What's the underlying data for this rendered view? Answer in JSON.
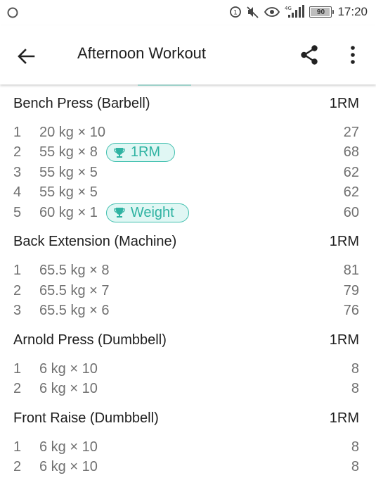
{
  "status_bar": {
    "time": "17:20",
    "battery": "90",
    "battery_level": 0.9,
    "network_label": "4G",
    "icons": [
      "circle-notification-icon",
      "data-saver-icon",
      "mute-icon",
      "eye-comfort-icon",
      "signal-icon",
      "battery-icon"
    ]
  },
  "app_bar": {
    "title": "Afternoon Workout",
    "icons": [
      "back-arrow-icon",
      "share-icon",
      "more-vert-icon"
    ]
  },
  "accent_color": "#3fbfae",
  "exercises": [
    {
      "name": "Bench Press (Barbell)",
      "metric": "1RM",
      "sets": [
        {
          "num": "1",
          "desc": "20 kg × 10",
          "value": "27",
          "badge": ""
        },
        {
          "num": "2",
          "desc": "55 kg × 8",
          "value": "68",
          "badge": "1RM"
        },
        {
          "num": "3",
          "desc": "55 kg × 5",
          "value": "62",
          "badge": ""
        },
        {
          "num": "4",
          "desc": "55 kg × 5",
          "value": "62",
          "badge": ""
        },
        {
          "num": "5",
          "desc": "60 kg × 1",
          "value": "60",
          "badge": "Weight"
        }
      ]
    },
    {
      "name": "Back Extension (Machine)",
      "metric": "1RM",
      "sets": [
        {
          "num": "1",
          "desc": "65.5 kg × 8",
          "value": "81",
          "badge": ""
        },
        {
          "num": "2",
          "desc": "65.5 kg × 7",
          "value": "79",
          "badge": ""
        },
        {
          "num": "3",
          "desc": "65.5 kg × 6",
          "value": "76",
          "badge": ""
        }
      ]
    },
    {
      "name": "Arnold Press (Dumbbell)",
      "metric": "1RM",
      "sets": [
        {
          "num": "1",
          "desc": "6 kg × 10",
          "value": "8",
          "badge": ""
        },
        {
          "num": "2",
          "desc": "6 kg × 10",
          "value": "8",
          "badge": ""
        }
      ]
    },
    {
      "name": "Front Raise (Dumbbell)",
      "metric": "1RM",
      "sets": [
        {
          "num": "1",
          "desc": "6 kg × 10",
          "value": "8",
          "badge": ""
        },
        {
          "num": "2",
          "desc": "6 kg × 10",
          "value": "8",
          "badge": ""
        }
      ]
    }
  ]
}
